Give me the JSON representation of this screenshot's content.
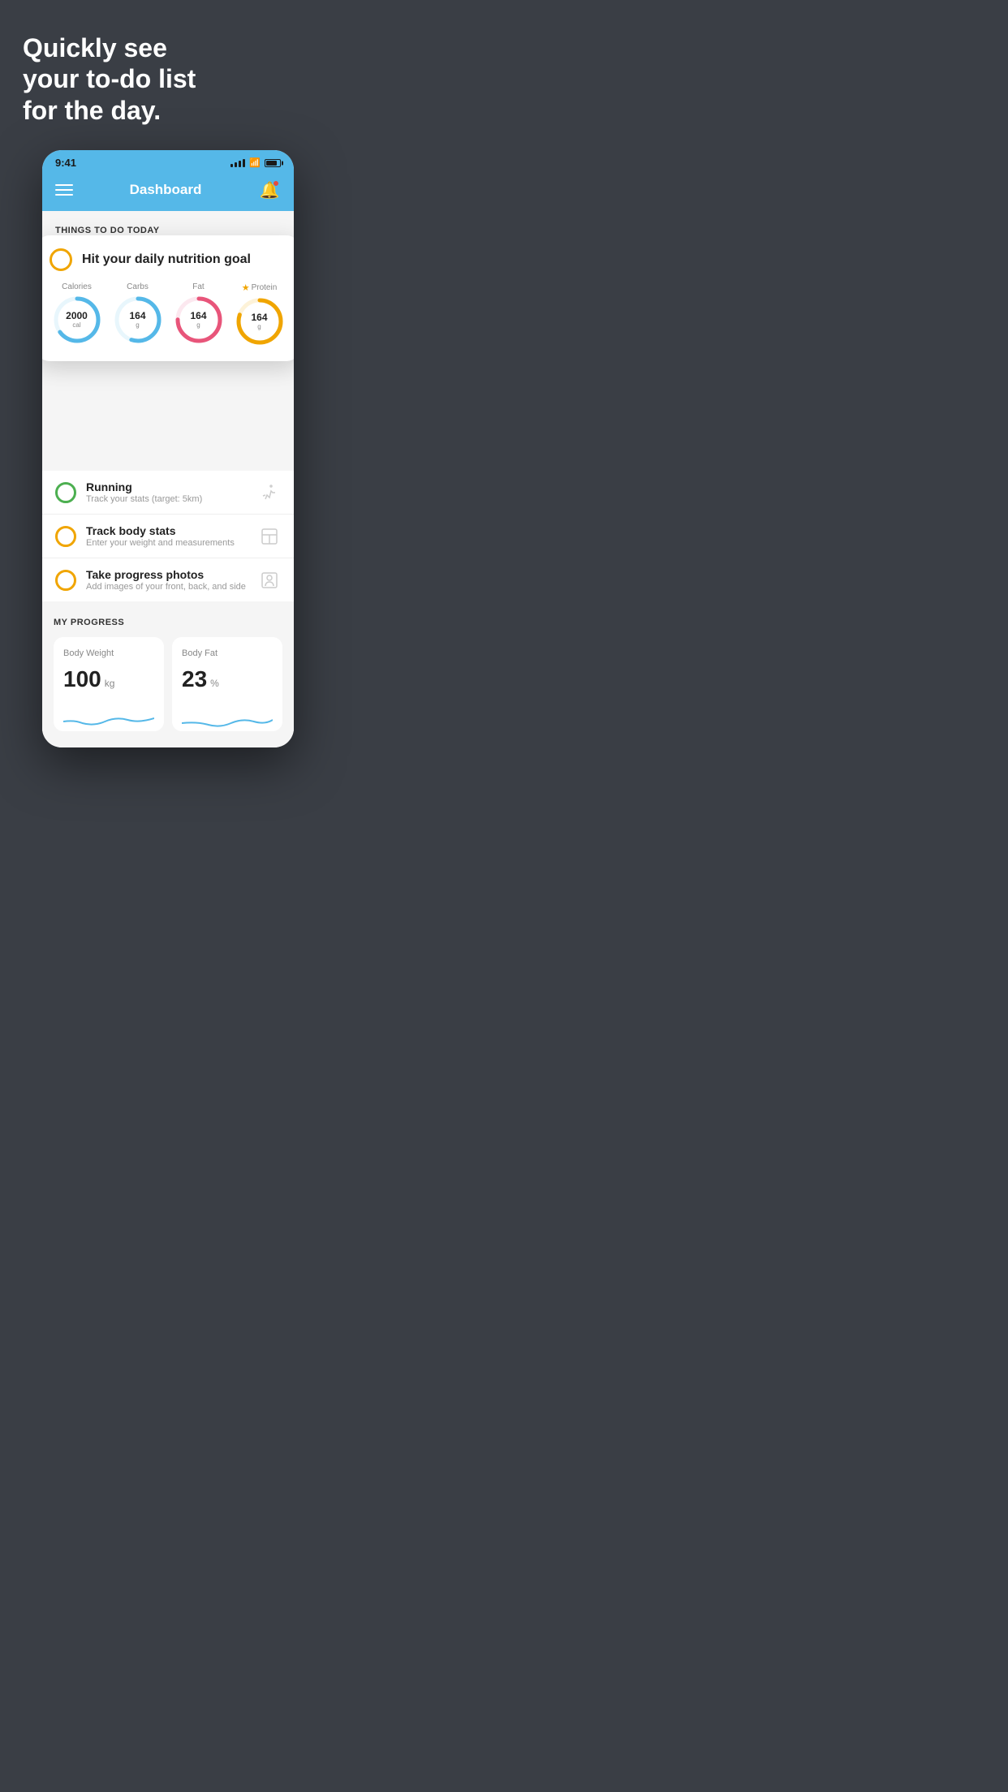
{
  "page": {
    "background_color": "#3a3e45",
    "hero": {
      "title": "Quickly see\nyour to-do list\nfor the day."
    },
    "phone": {
      "status_bar": {
        "time": "9:41",
        "signal_bars": 4,
        "wifi": true,
        "battery": 80
      },
      "nav": {
        "title": "Dashboard",
        "has_notification": true
      },
      "things_to_do_section": {
        "title": "THINGS TO DO TODAY"
      },
      "floating_card": {
        "check_color": "#f0a500",
        "title": "Hit your daily nutrition goal",
        "nutrition_items": [
          {
            "label": "Calories",
            "value": "2000",
            "unit": "cal",
            "color": "#55b8e8",
            "progress": 0.65,
            "has_star": false
          },
          {
            "label": "Carbs",
            "value": "164",
            "unit": "g",
            "color": "#55b8e8",
            "progress": 0.55,
            "has_star": false
          },
          {
            "label": "Fat",
            "value": "164",
            "unit": "g",
            "color": "#e8557a",
            "progress": 0.75,
            "has_star": false
          },
          {
            "label": "Protein",
            "value": "164",
            "unit": "g",
            "color": "#f0a500",
            "progress": 0.8,
            "has_star": true
          }
        ]
      },
      "todo_items": [
        {
          "title": "Running",
          "subtitle": "Track your stats (target: 5km)",
          "circle_color": "#4caf50",
          "icon": "shoe"
        },
        {
          "title": "Track body stats",
          "subtitle": "Enter your weight and measurements",
          "circle_color": "#f0a500",
          "icon": "scale"
        },
        {
          "title": "Take progress photos",
          "subtitle": "Add images of your front, back, and side",
          "circle_color": "#f0a500",
          "icon": "person"
        }
      ],
      "my_progress": {
        "title": "MY PROGRESS",
        "cards": [
          {
            "title": "Body Weight",
            "value": "100",
            "unit": "kg"
          },
          {
            "title": "Body Fat",
            "value": "23",
            "unit": "%"
          }
        ]
      }
    }
  }
}
